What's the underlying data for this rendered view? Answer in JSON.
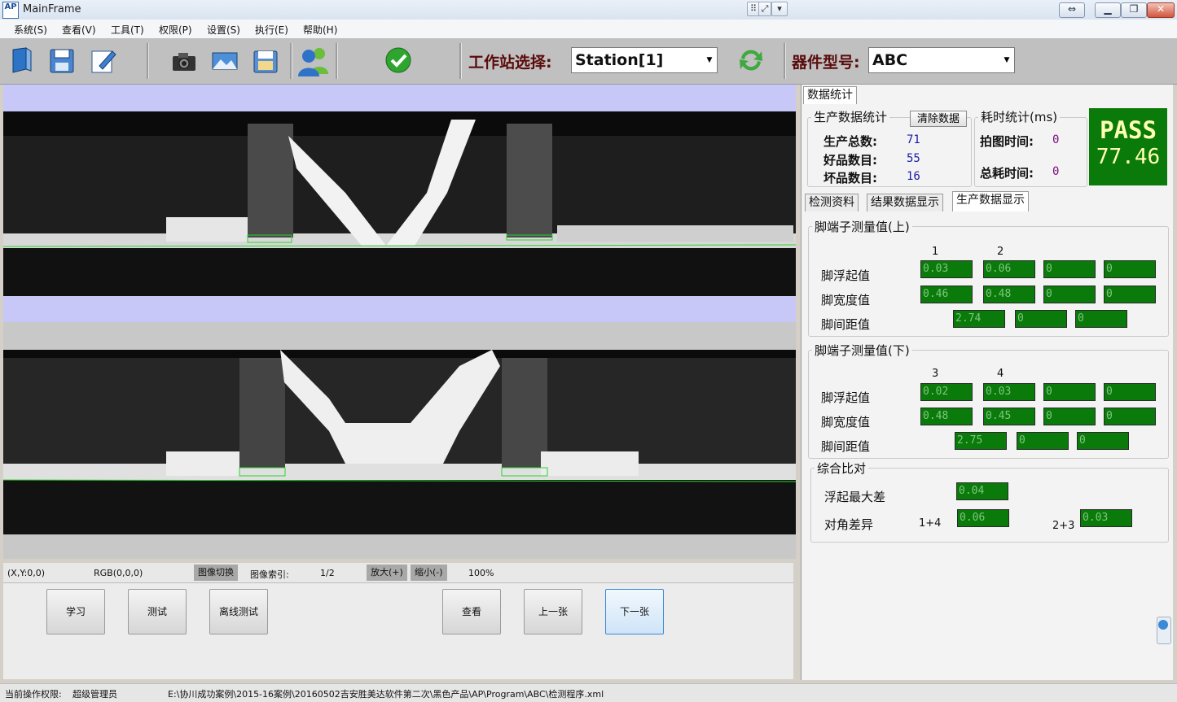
{
  "window": {
    "title": "MainFrame",
    "logo": "AP"
  },
  "menu": [
    "系统(S)",
    "查看(V)",
    "工具(T)",
    "权限(P)",
    "设置(S)",
    "执行(E)",
    "帮助(H)"
  ],
  "toolbar": {
    "station_label": "工作站选择:",
    "station_value": "Station[1]",
    "device_label": "器件型号:",
    "device_value": "ABC",
    "icons": [
      "open-file-icon",
      "save-icon",
      "edit-icon",
      "camera-icon",
      "image-icon",
      "image-save-icon",
      "users-icon",
      "check-icon",
      "refresh-icon"
    ]
  },
  "image_status": {
    "coords": "(X,Y:0,0)",
    "rgb": "RGB(0,0,0)",
    "switch_label": "图像切换",
    "index_label": "图像索引:",
    "index_value": "1/2",
    "zoom_in": "放大(+)",
    "zoom_out": "缩小(-)",
    "zoom_value": "100%"
  },
  "buttons": {
    "learn": "学习",
    "test": "测试",
    "offline_test": "离线测试",
    "view": "查看",
    "prev": "上一张",
    "next": "下一张"
  },
  "stats": {
    "tab": "数据统计",
    "production_title": "生产数据统计",
    "clear_button": "清除数据",
    "total_label": "生产总数:",
    "total": "71",
    "good_label": "好品数目:",
    "good": "55",
    "bad_label": "坏品数目:",
    "bad": "16",
    "time_title": "耗时统计(ms)",
    "photo_time_label": "拍图时间:",
    "photo_time": "0",
    "total_time_label": "总耗时间:",
    "total_time": "0",
    "result": "PASS",
    "score": "77.46"
  },
  "tabs": [
    "检测资料",
    "结果数据显示",
    "生产数据显示"
  ],
  "upper": {
    "title": "脚端子测量值(上)",
    "col1": "1",
    "col2": "2",
    "float_label": "脚浮起值",
    "float": [
      "0.03",
      "0.06",
      "0",
      "0"
    ],
    "width_label": "脚宽度值",
    "width": [
      "0.46",
      "0.48",
      "0",
      "0"
    ],
    "gap_label": "脚间距值",
    "gap": [
      "2.74",
      "0",
      "0"
    ]
  },
  "lower": {
    "title": "脚端子测量值(下)",
    "col1": "3",
    "col2": "4",
    "float_label": "脚浮起值",
    "float": [
      "0.02",
      "0.03",
      "0",
      "0"
    ],
    "width_label": "脚宽度值",
    "width": [
      "0.48",
      "0.45",
      "0",
      "0"
    ],
    "gap_label": "脚间距值",
    "gap": [
      "2.75",
      "0",
      "0"
    ]
  },
  "compare": {
    "title": "综合比对",
    "max_float_label": "浮起最大差",
    "max_float": "0.04",
    "diag_label": "对角差异",
    "diag1_label": "1+4",
    "diag1": "0.06",
    "diag2_label": "2+3",
    "diag2": "0.03"
  },
  "statusbar": {
    "permission_label": "当前操作权限:",
    "permission_value": "超级管理员",
    "path": "E:\\协川成功案例\\2015-16案例\\20160502吉安胜美达软件第二次\\黑色产品\\AP\\Program\\ABC\\检测程序.xml"
  },
  "colors": {
    "value_box": "#0a7a0a",
    "pass_text": "#ffffb0",
    "count_value": "#1a1aa8",
    "time_value": "#7a0a7a",
    "image_band": "#c8c8f8"
  }
}
